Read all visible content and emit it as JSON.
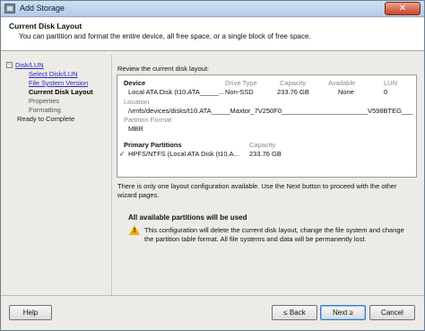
{
  "window": {
    "title": "Add Storage",
    "close_glyph": "✕"
  },
  "header": {
    "title": "Current Disk Layout",
    "subtitle": "You can partition and format the entire device, all free space, or a single block of free space."
  },
  "steps": [
    {
      "label": "Disk/LUN",
      "state": "link",
      "expander": "−"
    },
    {
      "label": "Select Disk/LUN",
      "state": "link"
    },
    {
      "label": "File System Version",
      "state": "link"
    },
    {
      "label": "Current Disk Layout",
      "state": "current"
    },
    {
      "label": "Properties",
      "state": "future"
    },
    {
      "label": "Formatting",
      "state": "future"
    },
    {
      "label": "Ready to Complete",
      "state": "plain"
    }
  ],
  "review": {
    "label": "Review the current disk layout:",
    "device_header": "Device",
    "drive_type_header": "Drive Type",
    "capacity_header": "Capacity",
    "available_header": "Available",
    "lun_header": "LUN",
    "device_name": "Local ATA Disk (t10.ATA_____...",
    "drive_type": "Non-SSD",
    "capacity": "233.76 GB",
    "available": "None",
    "lun": "0",
    "location_label": "Location",
    "location_value": "/vmfs/devices/disks/t10.ATA_____Maxtor_7V250F0_______________________V598BTEG___",
    "partition_format_label": "Partition Format",
    "partition_format_value": "MBR",
    "primary_partitions_header": "Primary Partitions",
    "pp_capacity_header": "Capacity",
    "partition_check": "✓",
    "partition_name": "HPFS/NTFS (Local ATA Disk (t10.A...",
    "partition_capacity": "233.76 GB"
  },
  "info_text": "There is only one layout configuration available. Use the Next button to proceed with the other wizard pages.",
  "warning": {
    "title": "All available partitions will be used",
    "icon": "warning-icon",
    "icon_mark": "!",
    "text": "This configuration will delete the current disk layout, change the file system and change the partition table format. All file systems and data will be permanently lost."
  },
  "buttons": {
    "help": "Help",
    "back": "≤ Back",
    "next": "Next ≥",
    "cancel": "Cancel"
  }
}
